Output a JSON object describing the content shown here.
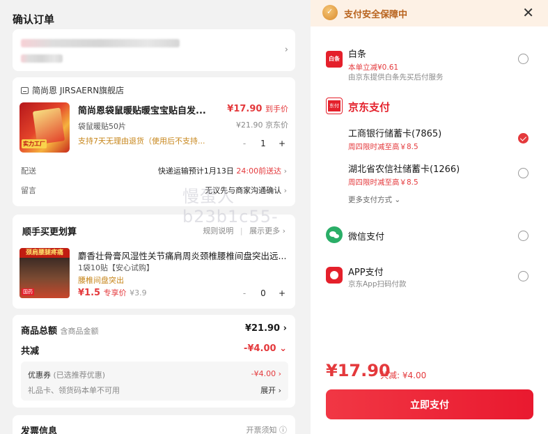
{
  "page_title": "确认订单",
  "shop": {
    "name": "简尚恩 JIRSAERN旗舰店",
    "product": {
      "title": "简尚恩袋鼠暖贴暖宝宝贴自发...",
      "spec": "袋鼠暖贴50片",
      "return_policy": "支持7天无理由退货（使用后不支持...",
      "price": "¥17.90",
      "price_suffix": "到手价",
      "orig_price": "¥21.90 京东价",
      "qty": "1",
      "img_badge": "实力工厂"
    },
    "delivery_label": "配送",
    "delivery_value": "快递运输预计1月13日",
    "delivery_time": "24:00前送达",
    "note_label": "留言",
    "note_value": "无议先与商家沟通确认"
  },
  "shunshou": {
    "title": "顺手买更划算",
    "rules": "规则说明",
    "more": "展示更多",
    "product": {
      "img_top": "颈肩腰腿疼痛",
      "img_tag": "国药",
      "title": "麝香壮骨膏风湿性关节痛肩周炎颈椎腰椎间盘突出远...",
      "sub": "1袋10贴【安心试购】",
      "tag": "腰椎间盘突出",
      "price": "¥1.5",
      "price_label": "专享价",
      "orig": "¥3.9",
      "qty": "0"
    }
  },
  "summary": {
    "total_label": "商品总额",
    "total_sub": "含商品金额",
    "total_value": "¥21.90",
    "discount_label": "共减",
    "discount_value": "-¥4.00",
    "coupon_label": "优惠券",
    "coupon_hint": "(已选推荐优惠)",
    "coupon_value": "-¥4.00",
    "gift_label": "礼品卡、领货码本单不可用",
    "expand": "展开"
  },
  "invoice": {
    "label": "发票信息",
    "link": "开票须知"
  },
  "watermark": "慢蛋人b23b1c55-",
  "pay": {
    "header": "支付安全保障中",
    "baitiao": {
      "name": "白条",
      "icon_text": "白条",
      "promo": "本单立减¥0.61",
      "desc": "由京东提供白条先买后付服务"
    },
    "jd_pay": {
      "title": "京东支付",
      "icon_text": "东付"
    },
    "card1": {
      "name": "工商银行储蓄卡(7865)",
      "promo": "周四限时减至高￥8.5"
    },
    "card2": {
      "name": "湖北省农信社储蓄卡(1266)",
      "promo": "周四限时减至高￥8.5"
    },
    "more": "更多支付方式",
    "wechat": {
      "name": "微信支付"
    },
    "app": {
      "name": "APP支付",
      "desc": "京东App扫码付款"
    },
    "total": "¥17.90",
    "total_discount": "共减: ¥4.00",
    "button": "立即支付"
  }
}
